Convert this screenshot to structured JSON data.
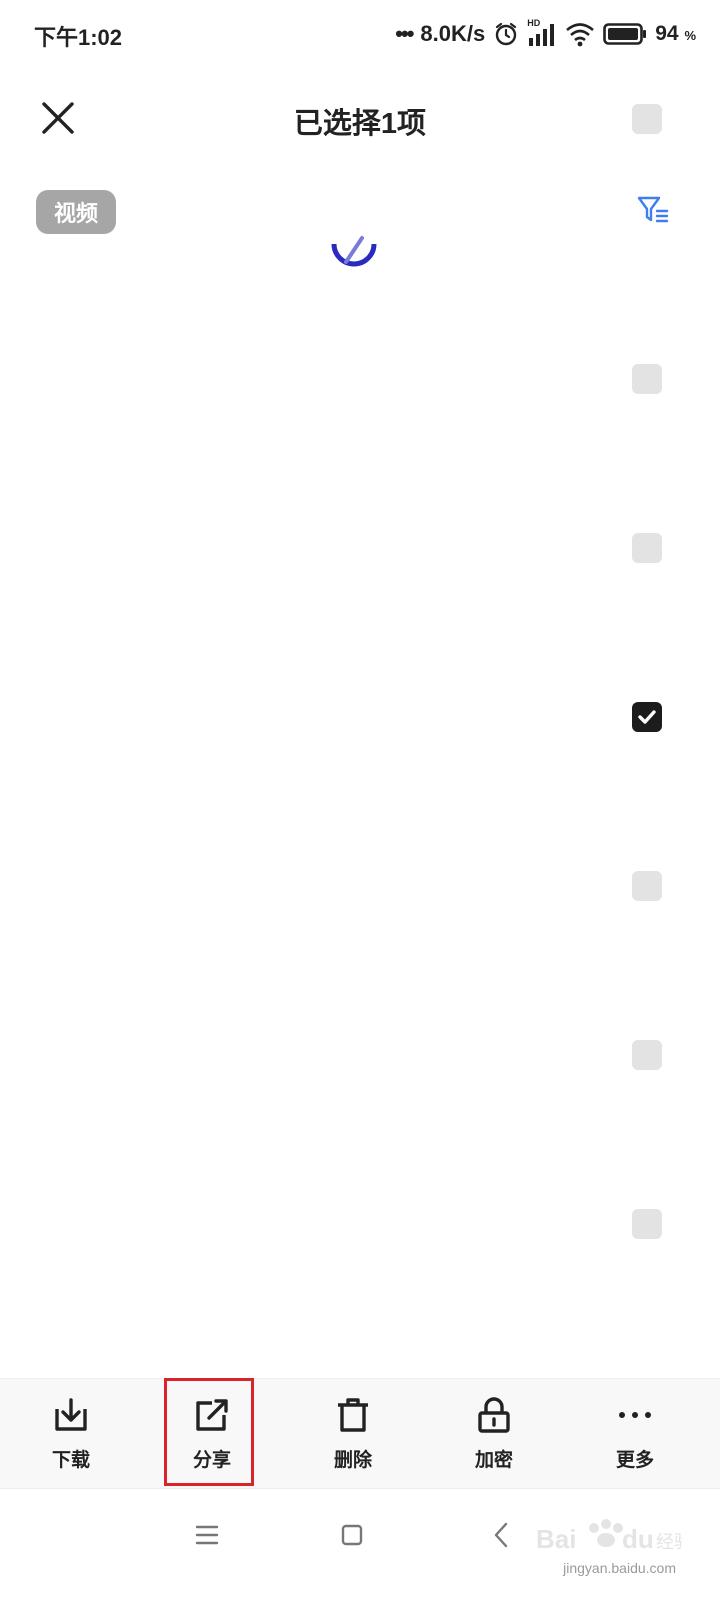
{
  "status_bar": {
    "time": "下午1:02",
    "dots": "•••",
    "net_speed": "8.0K/s",
    "battery_percent": "94",
    "battery_unit": "%",
    "signal_label": "HD"
  },
  "header": {
    "title": "已选择1项"
  },
  "filter": {
    "chip_label": "视频"
  },
  "rows": [
    {
      "checked": false
    },
    {
      "checked": false
    },
    {
      "checked": true
    },
    {
      "checked": false
    },
    {
      "checked": false
    },
    {
      "checked": false
    }
  ],
  "toolbar": {
    "download": "下载",
    "share": "分享",
    "delete": "删除",
    "encrypt": "加密",
    "more": "更多"
  },
  "watermark": {
    "text": "jingyan.baidu.com"
  },
  "colors": {
    "accent_blue": "#3f7df0",
    "loader_blue": "#2a2ac0",
    "highlight_red": "#d9232d",
    "chip_gray": "#a6a6a6"
  }
}
